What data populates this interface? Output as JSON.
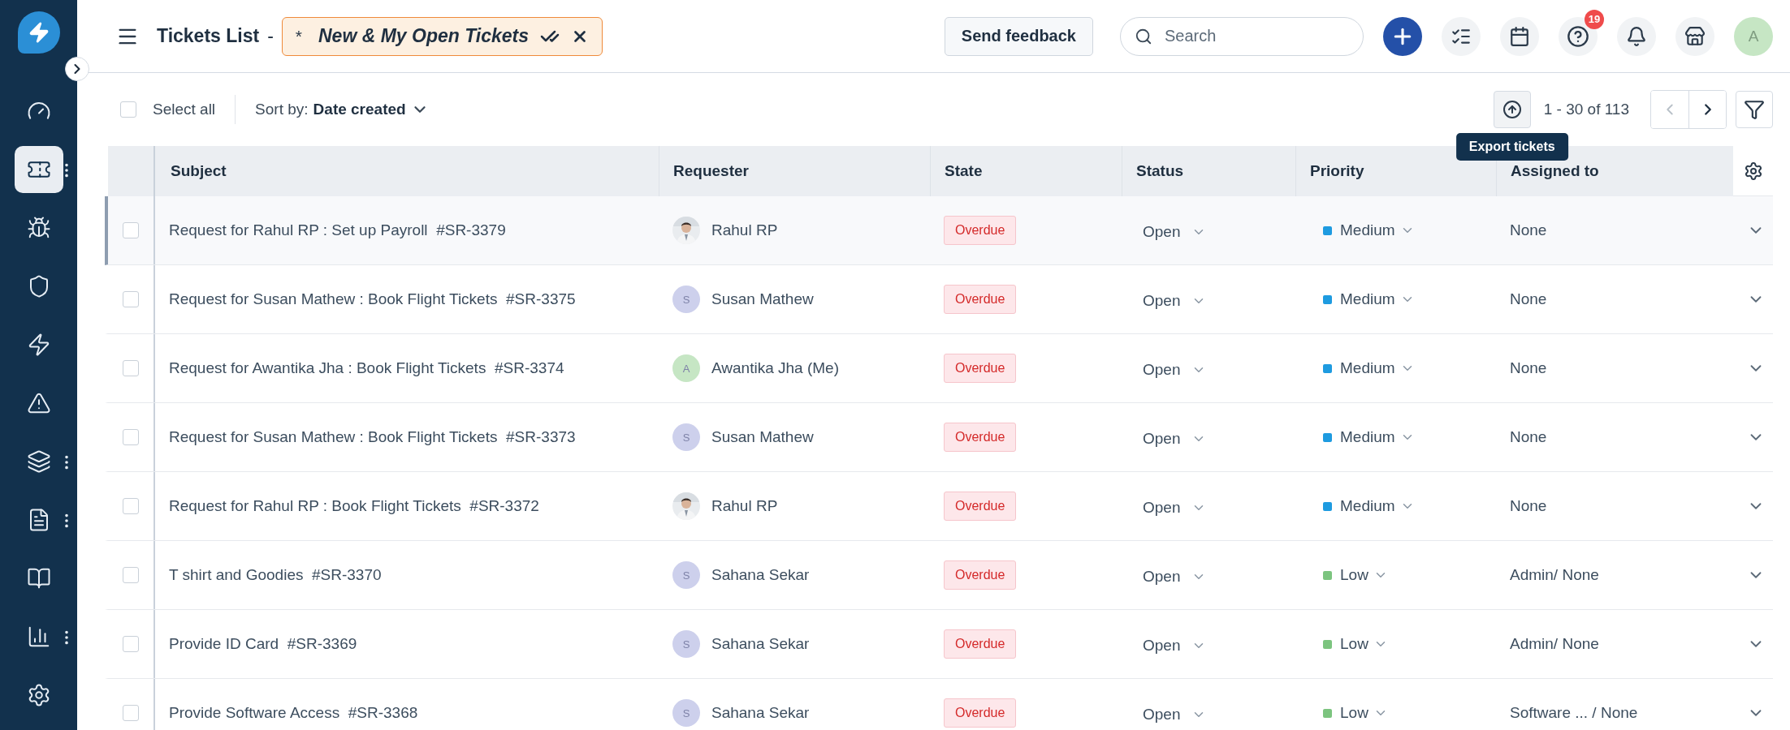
{
  "sidebar": {
    "items": [
      {
        "kind": "gauge",
        "selected": false,
        "has_menu": false
      },
      {
        "kind": "ticket",
        "selected": true,
        "has_menu": true
      },
      {
        "kind": "bug",
        "selected": false,
        "has_menu": false
      },
      {
        "kind": "shield",
        "selected": false,
        "has_menu": false
      },
      {
        "kind": "bolt",
        "selected": false,
        "has_menu": false
      },
      {
        "kind": "alert",
        "selected": false,
        "has_menu": false
      },
      {
        "kind": "layers",
        "selected": false,
        "has_menu": true
      },
      {
        "kind": "document",
        "selected": false,
        "has_menu": true
      },
      {
        "kind": "book",
        "selected": false,
        "has_menu": false
      },
      {
        "kind": "chart",
        "selected": false,
        "has_menu": true
      },
      {
        "kind": "gear",
        "selected": false,
        "has_menu": false
      }
    ]
  },
  "header": {
    "title": "Tickets List",
    "separator": "-",
    "view": {
      "prefix": "*",
      "name": "New & My Open Tickets"
    },
    "feedback": "Send feedback",
    "search_placeholder": "Search",
    "help_badge": "19",
    "avatar": "A"
  },
  "toolbar": {
    "select_all_checked": false,
    "select_all": "Select all",
    "sort_label": "Sort by:",
    "sort_value": "Date created",
    "pagination": "1 - 30 of 113",
    "tooltip": "Export tickets"
  },
  "table": {
    "columns": [
      "Subject",
      "Requester",
      "State",
      "Status",
      "Priority",
      "Assigned to"
    ],
    "rows": [
      {
        "selected": true,
        "checked": false,
        "subject": "Request for Rahul RP : Set up Payroll",
        "id": "#SR-3379",
        "requester": {
          "name": "Rahul RP"
        },
        "state": "Overdue",
        "status": "Open",
        "priority": {
          "label": "Medium",
          "color": "#1e9be0"
        },
        "assigned": "None"
      },
      {
        "selected": false,
        "checked": false,
        "subject": "Request for Susan Mathew : Book Flight Tickets",
        "id": "#SR-3375",
        "requester": {
          "name": "Susan Mathew",
          "kind": "initial",
          "initial": "S",
          "color": "#cdd0ec"
        },
        "state": "Overdue",
        "status": "Open",
        "priority": {
          "label": "Medium",
          "color": "#1e9be0"
        },
        "assigned": "None"
      },
      {
        "selected": false,
        "checked": false,
        "subject": "Request for Awantika Jha : Book Flight Tickets",
        "id": "#SR-3374",
        "requester": {
          "name": "Awantika Jha (Me)",
          "kind": "initial",
          "initial": "A",
          "color": "#c6e6c4"
        },
        "state": "Overdue",
        "status": "Open",
        "priority": {
          "label": "Medium",
          "color": "#1e9be0"
        },
        "assigned": "None"
      },
      {
        "selected": false,
        "checked": false,
        "subject": "Request for Susan Mathew : Book Flight Tickets",
        "id": "#SR-3373",
        "requester": {
          "name": "Susan Mathew",
          "kind": "initial",
          "initial": "S",
          "color": "#cdd0ec"
        },
        "state": "Overdue",
        "status": "Open",
        "priority": {
          "label": "Medium",
          "color": "#1e9be0"
        },
        "assigned": "None"
      },
      {
        "selected": false,
        "checked": false,
        "subject": "Request for Rahul RP : Book Flight Tickets",
        "id": "#SR-3372",
        "requester": {
          "name": "Rahul RP"
        },
        "state": "Overdue",
        "status": "Open",
        "priority": {
          "label": "Medium",
          "color": "#1e9be0"
        },
        "assigned": "None"
      },
      {
        "selected": false,
        "checked": false,
        "subject": "T shirt and Goodies",
        "id": "#SR-3370",
        "requester": {
          "name": "Sahana Sekar",
          "kind": "initial",
          "initial": "S",
          "color": "#cdd0ec"
        },
        "state": "Overdue",
        "status": "Open",
        "priority": {
          "label": "Low",
          "color": "#7cc47f"
        },
        "assigned": "Admin/ None"
      },
      {
        "selected": false,
        "checked": false,
        "subject": "Provide ID Card",
        "id": "#SR-3369",
        "requester": {
          "name": "Sahana Sekar",
          "kind": "initial",
          "initial": "S",
          "color": "#cdd0ec"
        },
        "state": "Overdue",
        "status": "Open",
        "priority": {
          "label": "Low",
          "color": "#7cc47f"
        },
        "assigned": "Admin/ None"
      },
      {
        "selected": false,
        "checked": false,
        "subject": "Provide Software Access",
        "id": "#SR-3368",
        "requester": {
          "name": "Sahana Sekar",
          "kind": "initial",
          "initial": "S",
          "color": "#cdd0ec"
        },
        "state": "Overdue",
        "status": "Open",
        "priority": {
          "label": "Low",
          "color": "#7cc47f"
        },
        "assigned": "Software ... / None"
      }
    ]
  }
}
